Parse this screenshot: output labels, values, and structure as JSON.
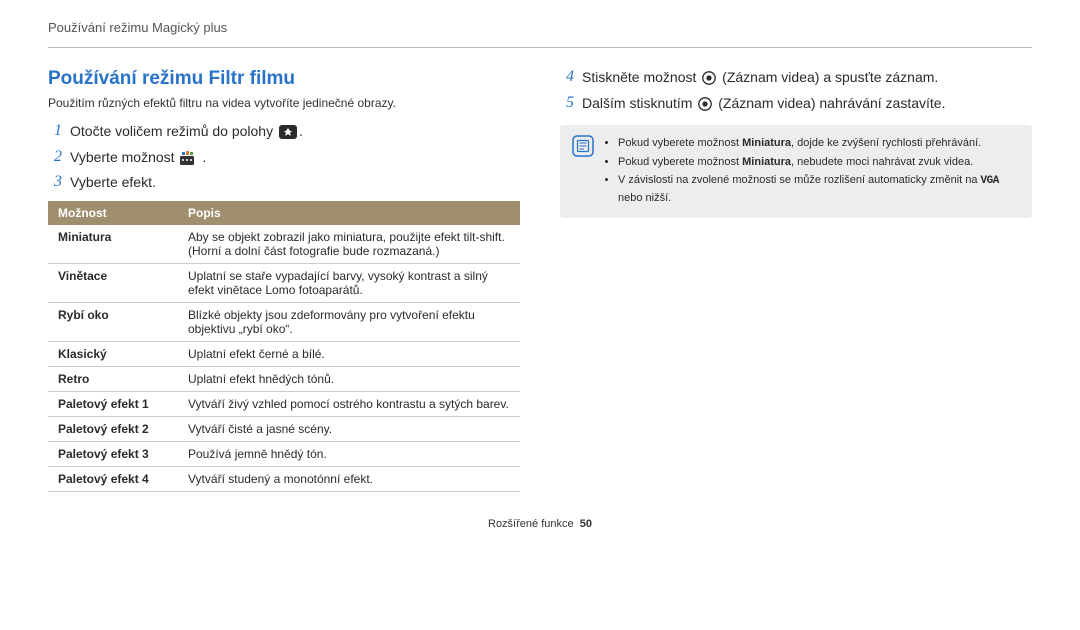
{
  "header": {
    "chapter_title": "Používání režimu Magický plus"
  },
  "left": {
    "heading": "Používání režimu Filtr filmu",
    "subtitle": "Použitím různých efektů filtru na videa vytvoříte jedinečné obrazy.",
    "steps": [
      {
        "n": "1",
        "text_pre": "Otočte voličem režimů do polohy ",
        "text_post": "."
      },
      {
        "n": "2",
        "text_pre": "Vyberte možnost ",
        "text_post": "."
      },
      {
        "n": "3",
        "text_pre": "Vyberte efekt.",
        "text_post": ""
      }
    ],
    "table": {
      "headers": [
        "Možnost",
        "Popis"
      ],
      "rows": [
        {
          "name": "Miniatura",
          "desc": "Aby se objekt zobrazil jako miniatura, použijte efekt tilt-shift. (Horní a dolní část fotografie bude rozmazaná.)"
        },
        {
          "name": "Vinětace",
          "desc": "Uplatní se staře vypadající barvy, vysoký kontrast a silný efekt vinětace Lomo fotoaparátů."
        },
        {
          "name": "Rybí oko",
          "desc": "Blízké objekty jsou zdeformovány pro vytvoření efektu objektivu „rybí oko“."
        },
        {
          "name": "Klasický",
          "desc": "Uplatní efekt černé a bílé."
        },
        {
          "name": "Retro",
          "desc": "Uplatní efekt hnědých tónů."
        },
        {
          "name": "Paletový efekt 1",
          "desc": "Vytváří živý vzhled pomocí ostrého kontrastu a sytých barev."
        },
        {
          "name": "Paletový efekt 2",
          "desc": "Vytváří čisté a jasné scény."
        },
        {
          "name": "Paletový efekt 3",
          "desc": "Používá jemně hnědý tón."
        },
        {
          "name": "Paletový efekt 4",
          "desc": "Vytváří studený a monotónní efekt."
        }
      ]
    }
  },
  "right": {
    "steps": [
      {
        "n": "4",
        "text_pre": "Stiskněte možnost ",
        "text_mid": " (Záznam videa) a spusťte záznam.",
        "icon": "record"
      },
      {
        "n": "5",
        "text_pre": "Dalším stisknutím ",
        "text_mid": " (Záznam videa) nahrávání zastavíte.",
        "icon": "record"
      }
    ],
    "note": {
      "bullets_html": [
        "Pokud vyberete možnost <b>Miniatura</b>, dojde ke zvýšení rychlosti přehrávání.",
        "Pokud vyberete možnost <b>Miniatura</b>, nebudete moci nahrávat zvuk videa.",
        "V závislosti na zvolené možnosti se může rozlišení automaticky změnit na <span class=\"vga\">VGA</span> nebo nižší."
      ]
    }
  },
  "footer": {
    "section": "Rozšířené funkce",
    "page": "50"
  }
}
